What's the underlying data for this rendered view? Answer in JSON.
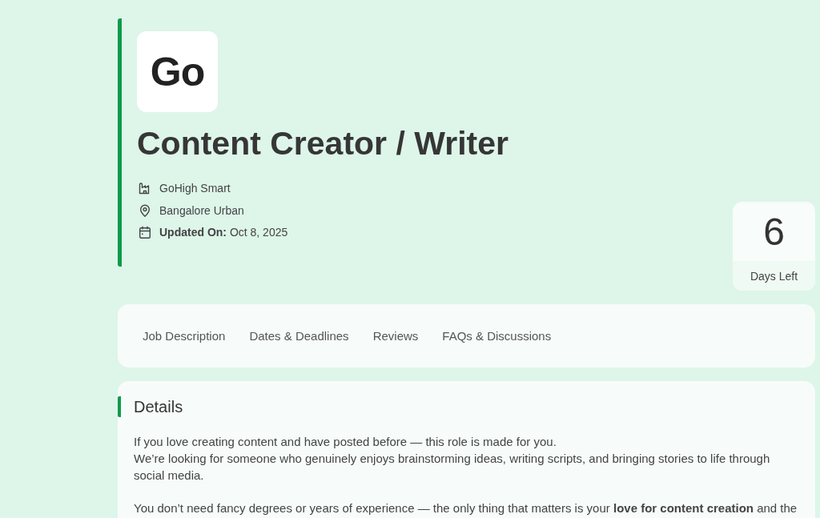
{
  "job": {
    "logo": "Go",
    "title": "Content Creator / Writer",
    "meta": [
      {
        "kind": "company",
        "text": "GoHigh Smart"
      },
      {
        "kind": "location",
        "text": "Bangalore Urban"
      },
      {
        "kind": "updated",
        "text": "**Updated On:** Oct 8, 2025"
      }
    ]
  },
  "days_left": {
    "count": "6",
    "label": "Days Left"
  },
  "tabs": [
    {
      "label": "Job Description"
    },
    {
      "label": "Dates & Deadlines"
    },
    {
      "label": "Reviews"
    },
    {
      "label": "FAQs & Discussions"
    }
  ],
  "details": {
    "heading": "Details",
    "paragraphs": [
      [
        "If you love creating content and have posted before — this role is made for you.",
        "We’re looking for someone who genuinely enjoys brainstorming ideas, writing scripts, and bringing stories to life through social media."
      ],
      [
        "You don’t need fancy degrees or years of experience — the only thing that matters is your **love for content creation** and the"
      ]
    ]
  }
}
